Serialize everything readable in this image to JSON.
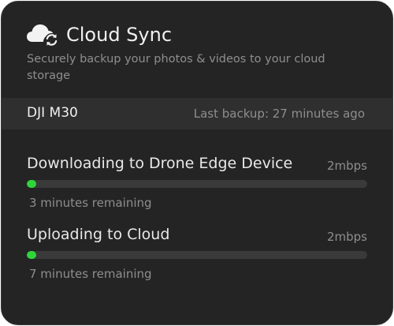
{
  "header": {
    "title": "Cloud Sync",
    "subtitle": "Securely backup your photos & videos to your cloud storage",
    "icon": "cloud-sync-icon"
  },
  "device": {
    "name": "DJI M30",
    "last_backup": "Last backup: 27 minutes ago"
  },
  "transfers": [
    {
      "label": "Downloading to Drone Edge Device",
      "rate": "2mbps",
      "remaining": "3 minutes remaining",
      "progress": 0.02
    },
    {
      "label": "Uploading to Cloud",
      "rate": "2mbps",
      "remaining": "7 minutes remaining",
      "progress": 0.02
    }
  ],
  "colors": {
    "background": "#242424",
    "row_highlight": "#2f2f2f",
    "progress_fill": "#2ed63a",
    "progress_track": "#3a3a3a",
    "muted_text": "#8e8e8e"
  }
}
